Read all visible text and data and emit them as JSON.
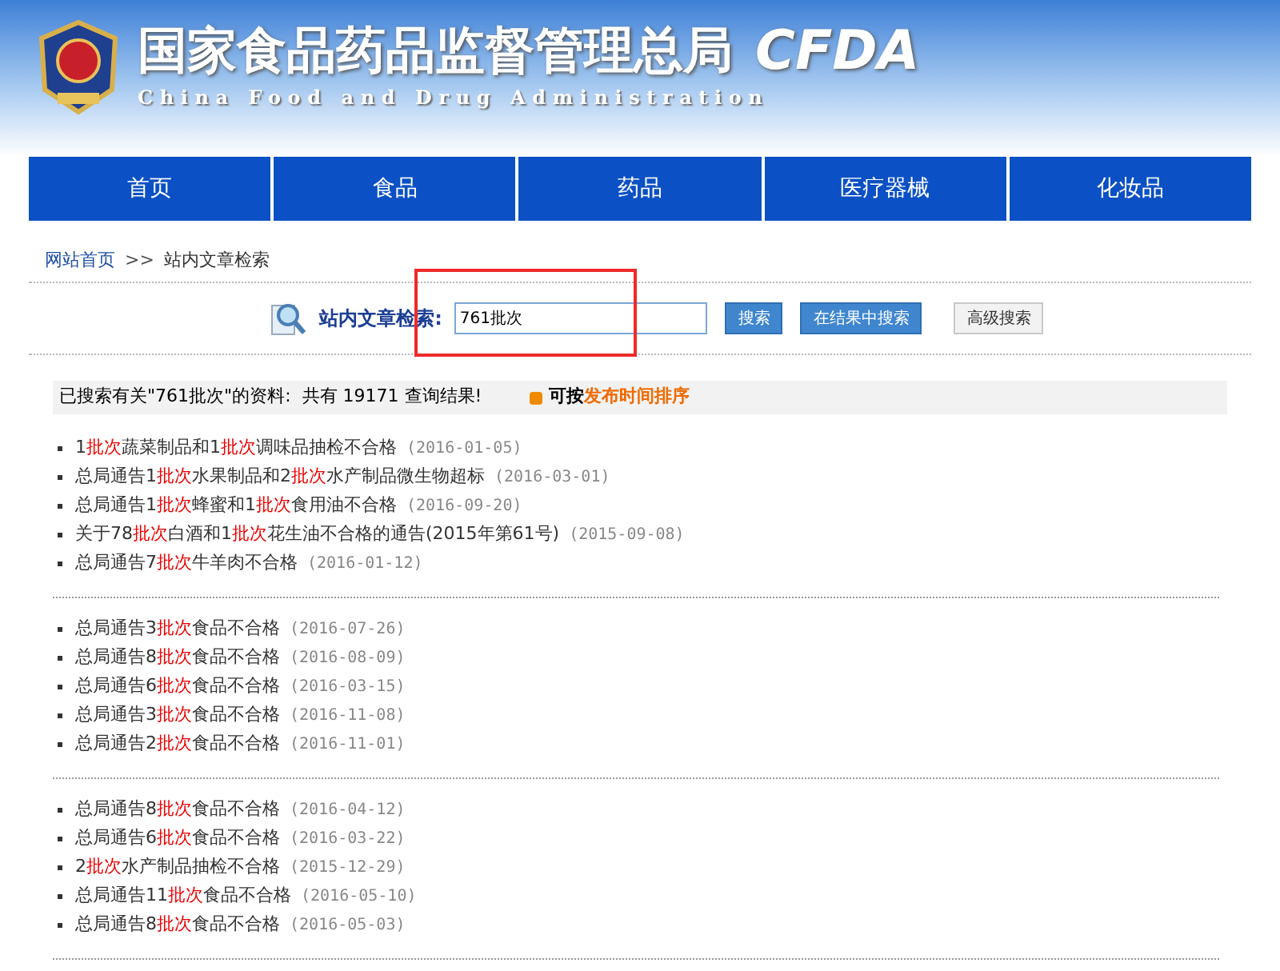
{
  "header": {
    "title": "国家食品药品监督管理总局",
    "subtitle": "China Food and Drug Administration",
    "logo_text": "CFDA"
  },
  "nav": [
    {
      "label": "首页"
    },
    {
      "label": "食品"
    },
    {
      "label": "药品"
    },
    {
      "label": "医疗器械"
    },
    {
      "label": "化妆品"
    }
  ],
  "breadcrumb": {
    "link": "网站首页",
    "separator": ">>",
    "current": "站内文章检索"
  },
  "search": {
    "label": "站内文章检索:",
    "value": "761批次",
    "buttons": [
      {
        "label": "搜索",
        "kind": "primary"
      },
      {
        "label": "在结果中搜索",
        "kind": "primary"
      },
      {
        "label": "高级搜索",
        "kind": "plain"
      }
    ]
  },
  "annotation_box": {
    "color": "#ee2a2a"
  },
  "summary": {
    "text": "已搜索有关\"761批次\"的资料:  共有 19171 查询结果!",
    "sort_prefix": "可按",
    "sort_link": "发布时间排序"
  },
  "result_groups": [
    [
      {
        "title": [
          {
            "text": "1"
          },
          {
            "text": "批次",
            "highlight": true
          },
          {
            "text": "蔬菜制品和1"
          },
          {
            "text": "批次",
            "highlight": true
          },
          {
            "text": "调味品抽检不合格"
          }
        ],
        "date": "(2016-01-05)"
      },
      {
        "title": [
          {
            "text": "总局通告1"
          },
          {
            "text": "批次",
            "highlight": true
          },
          {
            "text": "水果制品和2"
          },
          {
            "text": "批次",
            "highlight": true
          },
          {
            "text": "水产制品微生物超标"
          }
        ],
        "date": "(2016-03-01)"
      },
      {
        "title": [
          {
            "text": "总局通告1"
          },
          {
            "text": "批次",
            "highlight": true
          },
          {
            "text": "蜂蜜和1"
          },
          {
            "text": "批次",
            "highlight": true
          },
          {
            "text": "食用油不合格"
          }
        ],
        "date": "(2016-09-20)"
      },
      {
        "title": [
          {
            "text": "关于78"
          },
          {
            "text": "批次",
            "highlight": true
          },
          {
            "text": "白酒和1"
          },
          {
            "text": "批次",
            "highlight": true
          },
          {
            "text": "花生油不合格的通告(2015年第61号)"
          }
        ],
        "date": "(2015-09-08)"
      },
      {
        "title": [
          {
            "text": "总局通告7"
          },
          {
            "text": "批次",
            "highlight": true
          },
          {
            "text": "牛羊肉不合格"
          }
        ],
        "date": "(2016-01-12)"
      }
    ],
    [
      {
        "title": [
          {
            "text": "总局通告3"
          },
          {
            "text": "批次",
            "highlight": true
          },
          {
            "text": "食品不合格"
          }
        ],
        "date": "(2016-07-26)"
      },
      {
        "title": [
          {
            "text": "总局通告8"
          },
          {
            "text": "批次",
            "highlight": true
          },
          {
            "text": "食品不合格"
          }
        ],
        "date": "(2016-08-09)"
      },
      {
        "title": [
          {
            "text": "总局通告6"
          },
          {
            "text": "批次",
            "highlight": true
          },
          {
            "text": "食品不合格"
          }
        ],
        "date": "(2016-03-15)"
      },
      {
        "title": [
          {
            "text": "总局通告3"
          },
          {
            "text": "批次",
            "highlight": true
          },
          {
            "text": "食品不合格"
          }
        ],
        "date": "(2016-11-08)"
      },
      {
        "title": [
          {
            "text": "总局通告2"
          },
          {
            "text": "批次",
            "highlight": true
          },
          {
            "text": "食品不合格"
          }
        ],
        "date": "(2016-11-01)"
      }
    ],
    [
      {
        "title": [
          {
            "text": "总局通告8"
          },
          {
            "text": "批次",
            "highlight": true
          },
          {
            "text": "食品不合格"
          }
        ],
        "date": "(2016-04-12)"
      },
      {
        "title": [
          {
            "text": "总局通告6"
          },
          {
            "text": "批次",
            "highlight": true
          },
          {
            "text": "食品不合格"
          }
        ],
        "date": "(2016-03-22)"
      },
      {
        "title": [
          {
            "text": "2"
          },
          {
            "text": "批次",
            "highlight": true
          },
          {
            "text": "水产制品抽检不合格"
          }
        ],
        "date": "(2015-12-29)"
      },
      {
        "title": [
          {
            "text": "总局通告11"
          },
          {
            "text": "批次",
            "highlight": true
          },
          {
            "text": "食品不合格"
          }
        ],
        "date": "(2016-05-10)"
      },
      {
        "title": [
          {
            "text": "总局通告8"
          },
          {
            "text": "批次",
            "highlight": true
          },
          {
            "text": "食品不合格"
          }
        ],
        "date": "(2016-05-03)"
      }
    ]
  ]
}
